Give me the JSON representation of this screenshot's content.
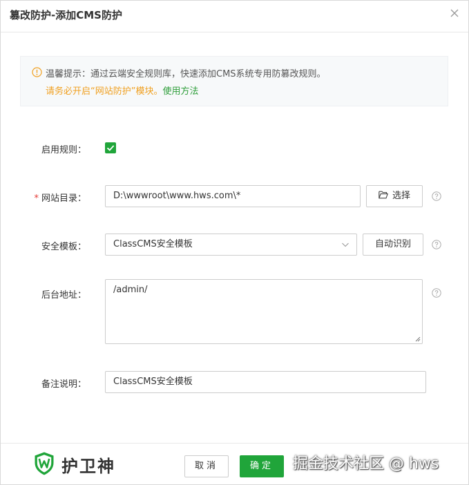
{
  "dialog": {
    "title": "篡改防护-添加CMS防护"
  },
  "notice": {
    "line1": "温馨提示：通过云端安全规则库，快速添加CMS系统专用防篡改规则。",
    "line2_text": "请务必开启“网站防护”模块。",
    "line2_link": "使用方法"
  },
  "form": {
    "enable_label": "启用规则：",
    "enable_checked": true,
    "required_mark": "*",
    "site_dir_label": "网站目录：",
    "site_dir_value": "D:\\wwwroot\\www.hws.com\\*",
    "choose_button": "选择",
    "template_label": "安全模板：",
    "template_value": "ClassCMS安全模板",
    "auto_detect_button": "自动识别",
    "admin_label": "后台地址：",
    "admin_value": "/admin/",
    "remark_label": "备注说明：",
    "remark_value": "ClassCMS安全模板"
  },
  "footer": {
    "brand": "护卫神",
    "cancel": "取消",
    "confirm": "确定",
    "watermark": "掘金技术社区 @ hws"
  },
  "colors": {
    "accent": "#20a53a",
    "warning": "#f0a020",
    "required": "#e53935"
  },
  "icons": {
    "close": "close-icon",
    "notice": "warning-circle-icon",
    "check": "check-icon",
    "folder": "folder-open-icon",
    "help": "question-circle-icon",
    "select_arrow": "chevron-down-icon",
    "logo": "shield-w-icon"
  }
}
